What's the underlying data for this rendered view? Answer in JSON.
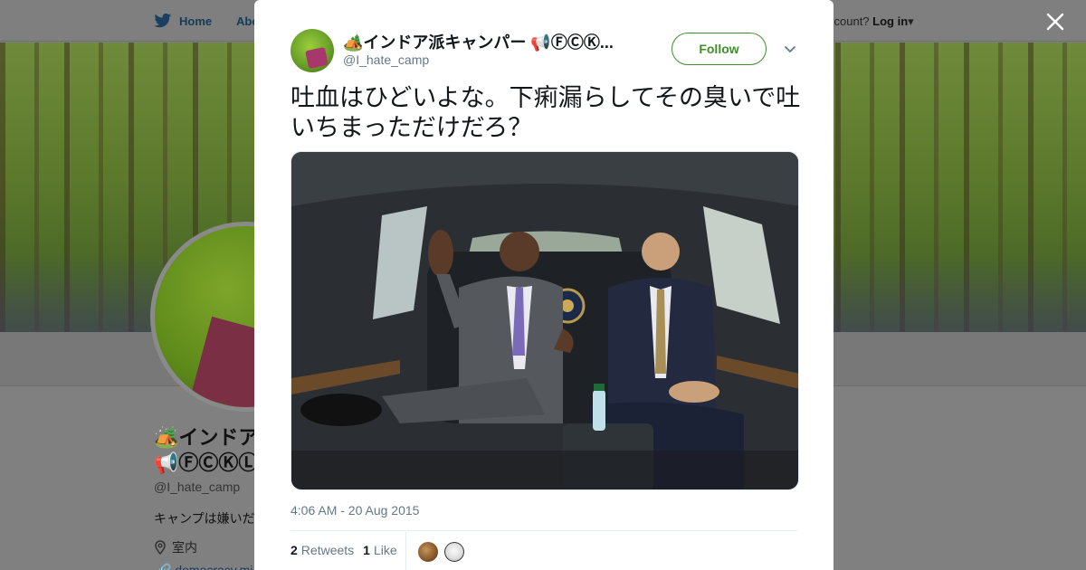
{
  "background": {
    "nav": {
      "home_label": "Home",
      "about_label": "Abo",
      "login_prefix": "ccount?",
      "login_label": "Log in"
    },
    "profile": {
      "name_line1": "🏕️インドア",
      "name_line2": "📢ⒻⒸⓀⓁ",
      "handle": "@I_hate_camp",
      "bio": "キャンプは嫌いだ",
      "location": "室内",
      "url": "democracy.mi"
    }
  },
  "tweet": {
    "author_name": "🏕️インドア派キャンパー 📢ⒻⒸⓀ...",
    "author_handle": "@I_hate_camp",
    "follow_label": "Follow",
    "text": "吐血はひどいよな。下痢漏らしてその臭いで吐いちまっただけだろ？",
    "timestamp": "4:06 AM - 20 Aug 2015",
    "retweets_count": "2",
    "retweets_label": "Retweets",
    "likes_count": "1",
    "likes_label": "Like"
  },
  "icons": {
    "home": "twitter-bird-icon",
    "close": "close-icon",
    "caret": "chevron-down-icon",
    "location": "map-pin-icon",
    "link": "link-icon"
  },
  "colors": {
    "follow": "#3f8e2a",
    "text": "#14171a",
    "secondary": "#657786"
  }
}
